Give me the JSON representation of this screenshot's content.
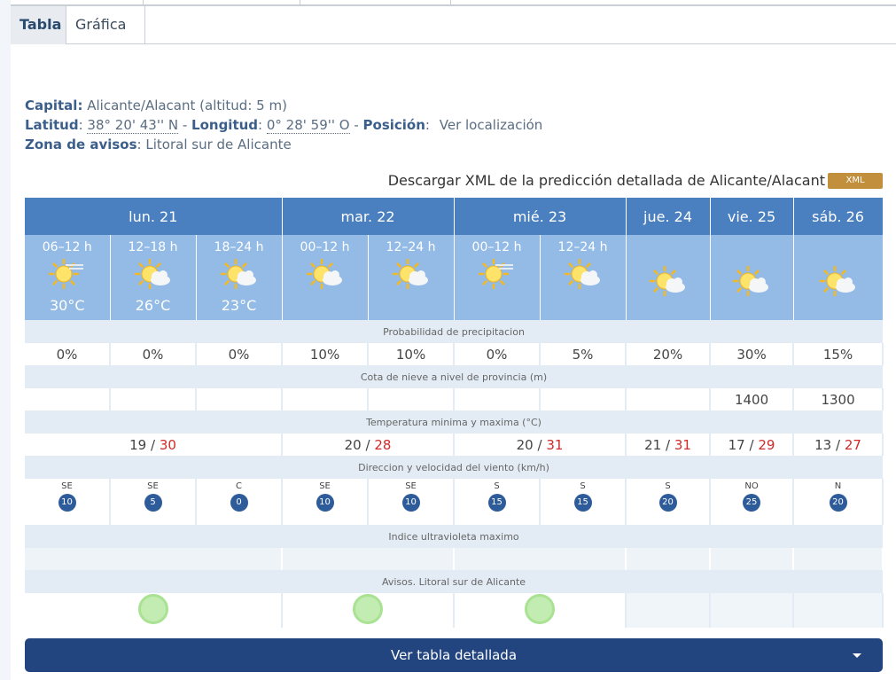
{
  "tabs": {
    "tabla": "Tabla",
    "grafica": "Gráfica"
  },
  "info": {
    "capital_label": "Capital:",
    "capital_value": "Alicante/Alacant (altitud: 5 m)",
    "latitud_label": "Latitud",
    "latitud_value": "38° 20' 43'' N",
    "longitud_label": "Longitud",
    "longitud_value": "0° 28' 59'' O",
    "posicion_label": "Posición",
    "posicion_link": "Ver localización",
    "zona_label": "Zona de avisos",
    "zona_value": "Litoral sur de Alicante"
  },
  "xml": {
    "text": "Descargar XML de la predicción detallada de Alicante/Alacant",
    "button": "XML"
  },
  "days": [
    "lun. 21",
    "mar. 22",
    "mié. 23",
    "jue. 24",
    "vie. 25",
    "sáb. 26"
  ],
  "periods": [
    {
      "time": "06–12 h",
      "icon": "sun-haze-icon",
      "temp": "30°C"
    },
    {
      "time": "12–18 h",
      "icon": "sun-cloud-icon",
      "temp": "26°C"
    },
    {
      "time": "18–24 h",
      "icon": "sun-cloud-icon",
      "temp": "23°C"
    },
    {
      "time": "00–12 h",
      "icon": "sun-cloud-icon",
      "temp": ""
    },
    {
      "time": "12–24 h",
      "icon": "sun-cloud-icon",
      "temp": ""
    },
    {
      "time": "00–12 h",
      "icon": "sun-haze-icon",
      "temp": ""
    },
    {
      "time": "12–24 h",
      "icon": "sun-cloud-icon",
      "temp": ""
    },
    {
      "time": "",
      "icon": "sun-cloud-icon",
      "temp": ""
    },
    {
      "time": "",
      "icon": "sun-cloud-icon",
      "temp": ""
    },
    {
      "time": "",
      "icon": "sun-cloud-icon",
      "temp": ""
    }
  ],
  "labels": {
    "precip": "Probabilidad de precipitacion",
    "nieve": "Cota de nieve a nivel de provincia (m)",
    "temp": "Temperatura minima y maxima (°C)",
    "viento": "Direccion y velocidad del viento (km/h)",
    "uv": "Indice ultravioleta maximo",
    "avisos": "Avisos. Litoral sur de Alicante"
  },
  "precip": [
    "0%",
    "0%",
    "0%",
    "10%",
    "10%",
    "0%",
    "5%",
    "20%",
    "30%",
    "15%"
  ],
  "nieve": [
    "",
    "",
    "",
    "",
    "",
    "",
    "",
    "",
    "1400",
    "1300"
  ],
  "temps": [
    {
      "min": "19",
      "max": "30"
    },
    {
      "min": "20",
      "max": "28"
    },
    {
      "min": "20",
      "max": "31"
    },
    {
      "min": "21",
      "max": "31"
    },
    {
      "min": "17",
      "max": "29"
    },
    {
      "min": "13",
      "max": "27"
    }
  ],
  "wind": [
    {
      "dir": "SE",
      "speed": "10"
    },
    {
      "dir": "SE",
      "speed": "5"
    },
    {
      "dir": "C",
      "speed": "0"
    },
    {
      "dir": "SE",
      "speed": "10"
    },
    {
      "dir": "SE",
      "speed": "10"
    },
    {
      "dir": "S",
      "speed": "15"
    },
    {
      "dir": "S",
      "speed": "15"
    },
    {
      "dir": "S",
      "speed": "20"
    },
    {
      "dir": "NO",
      "speed": "25"
    },
    {
      "dir": "N",
      "speed": "20"
    }
  ],
  "avisos": [
    "green",
    "green",
    "green",
    "none",
    "none",
    "none"
  ],
  "detalle_button": "Ver tabla detallada",
  "colors": {
    "header_blue": "#4a7fc0",
    "period_blue": "#93bbe5",
    "max_red": "#d02a2a",
    "button_navy": "#23457f",
    "xml_gold": "#c28f3c"
  }
}
